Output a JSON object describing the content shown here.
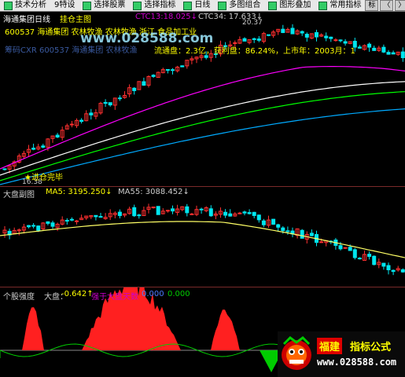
{
  "toolbar": {
    "items": [
      "技术分析",
      "9特设",
      "选择股票",
      "选择指标",
      "日线",
      "多图组合",
      "图形叠加",
      "常用指标"
    ],
    "right_buttons": [
      "标",
      "〈",
      "〉"
    ]
  },
  "main_panel": {
    "title": "海通集团日线",
    "indicator_name": "挂仓主图",
    "ctc_label": "CTC34: 17.633↓",
    "ctc_prefix": "CTC13:18.025↓",
    "stock_line": "600537 海通集团 农林牧渔 农林牧渔 浙江 食品加工业",
    "watermark": "www.028588.com",
    "dim_line": "筹码CXR 600537 海通集团 农林牧渔",
    "info_line": "流通盘：2.3亿，获利盘：86.24%，上市年：2003月：1",
    "high_label": "20.37",
    "low_label": "16.38",
    "entry_label": "★进仓完毕",
    "colors": {
      "up": "#ff3030",
      "down": "#00e5ee",
      "ma1": "#ffffff",
      "ma2": "#ff00ff",
      "ma3": "#00ff00",
      "ma4": "#00aaff"
    }
  },
  "sub_panel": {
    "title": "大盘副图",
    "ma5": "MA5: 3195.250↓",
    "ma55": "MA55: 3088.452↓"
  },
  "strength_panel": {
    "title": "个股强度",
    "market_label": "大盘：",
    "market_value": "-0.642↑",
    "stronger_label": "强于大盘天数",
    "value1": "0.000",
    "value2": "0.000"
  },
  "logo": {
    "tag": "福建",
    "title": "指标公式",
    "url": "www.028588.com"
  }
}
